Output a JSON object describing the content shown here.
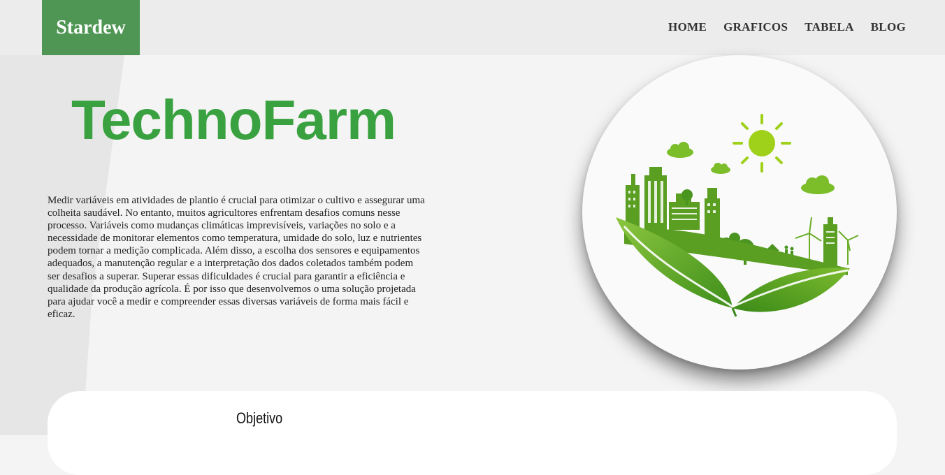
{
  "brand": {
    "name": "Stardew",
    "color": "#4f9655"
  },
  "nav": {
    "items": [
      {
        "label": "HOME"
      },
      {
        "label": "GRAFICOS"
      },
      {
        "label": "TABELA"
      },
      {
        "label": "BLOG"
      }
    ]
  },
  "hero": {
    "title": "TechnoFarm",
    "title_color": "#39a13f",
    "description": "Medir variáveis em atividades de plantio é crucial para otimizar o cultivo e assegurar uma colheita saudável. No entanto, muitos agricultores enfrentam desafios comuns nesse processo. Variáveis como mudanças climáticas imprevisíveis, variações no solo e a necessidade de monitorar elementos como temperatura, umidade do solo, luz e nutrientes podem tornar a medição complicada. Além disso, a escolha dos sensores e equipamentos adequados, a manutenção regular e a interpretação dos dados coletados também podem ser desafios a superar. Superar essas dificuldades é crucial para garantir a eficiência e qualidade da produção agrícola. É por isso que desenvolvemos o uma solução projetada para ajudar você a medir e compreender essas diversas variáveis de forma mais fácil e eficaz.",
    "illustration": "eco-city-on-leaves-illustration"
  },
  "objective": {
    "title": "Objetivo"
  }
}
